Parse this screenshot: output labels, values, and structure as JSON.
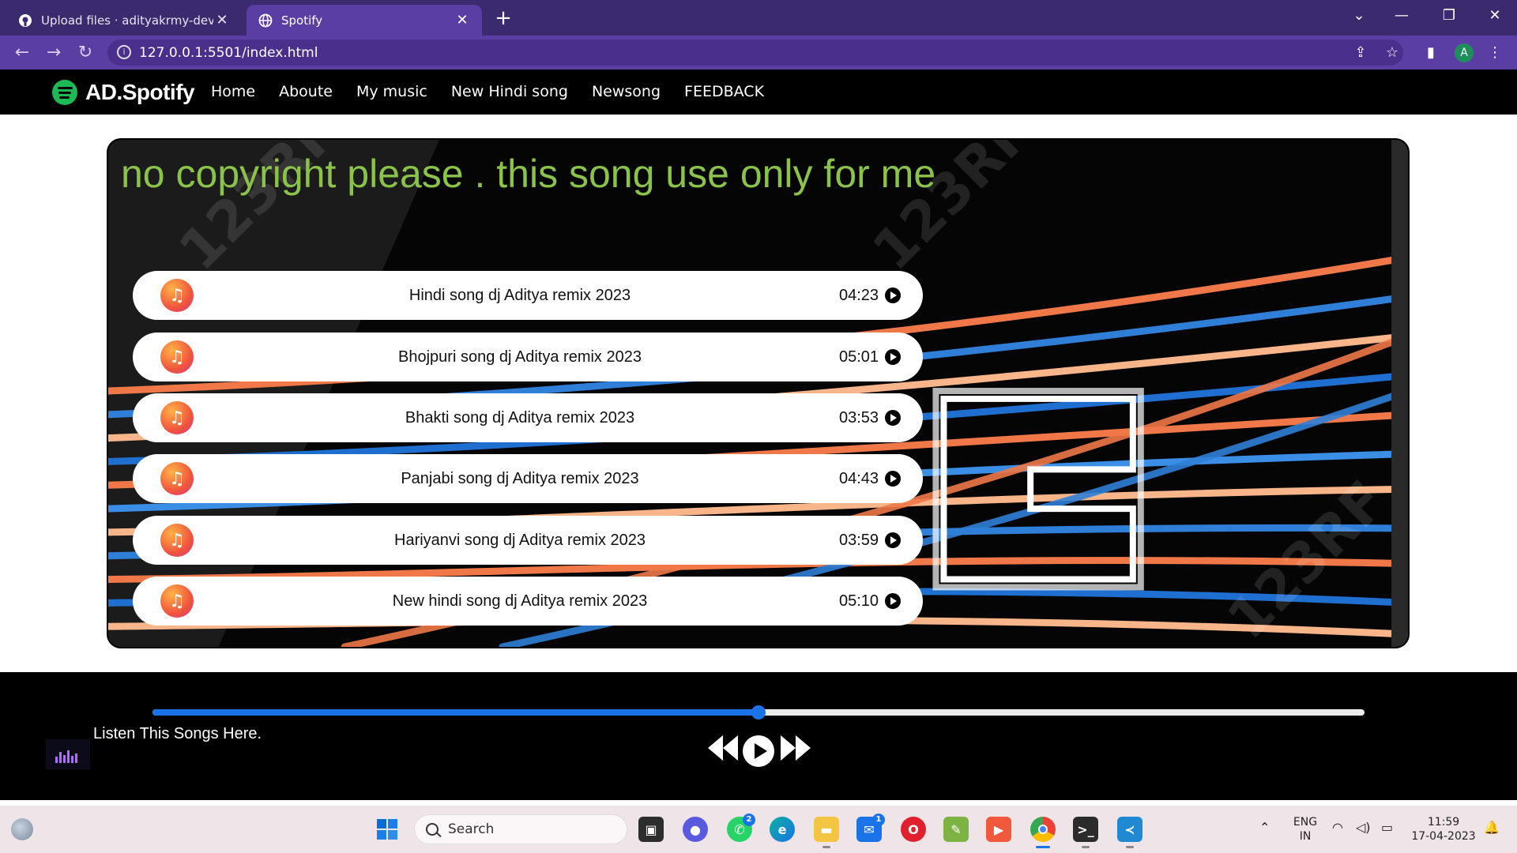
{
  "browser": {
    "tabs": [
      {
        "title": "Upload files · adityakrmy-dev/Sp",
        "active": false,
        "icon": "github-icon"
      },
      {
        "title": "Spotify",
        "active": true,
        "icon": "globe-icon"
      }
    ],
    "url": "127.0.0.1:5501/index.html",
    "profile_initial": "A",
    "theme_color": "#5b3ea3"
  },
  "site": {
    "brand": "AD.Spotify",
    "brand_color": "#1db954",
    "nav": [
      "Home",
      "Aboute",
      "My music",
      "New Hindi song",
      "Newsong",
      "FEEDBACK"
    ],
    "banner_title": "no copyright please . this song use only for me",
    "banner_title_color": "#8bc34a",
    "songs": [
      {
        "name": "Hindi song dj Aditya remix 2023",
        "duration": "04:23"
      },
      {
        "name": "Bhojpuri song dj Aditya remix 2023",
        "duration": "05:01"
      },
      {
        "name": "Bhakti song dj Aditya remix 2023",
        "duration": "03:53"
      },
      {
        "name": "Panjabi song dj Aditya remix 2023",
        "duration": "04:43"
      },
      {
        "name": "Hariyanvi song dj Aditya remix 2023",
        "duration": "03:59"
      },
      {
        "name": "New hindi song dj Aditya remix 2023",
        "duration": "05:10"
      }
    ]
  },
  "player": {
    "now_playing_text": "Listen This Songs Here.",
    "progress_fraction": 0.5,
    "accent_color": "#1a73e8"
  },
  "taskbar": {
    "search_placeholder": "Search",
    "whatsapp_badge": "2",
    "mail_badge": "1",
    "lang_top": "ENG",
    "lang_bottom": "IN",
    "time": "11:59",
    "date": "17-04-2023"
  }
}
